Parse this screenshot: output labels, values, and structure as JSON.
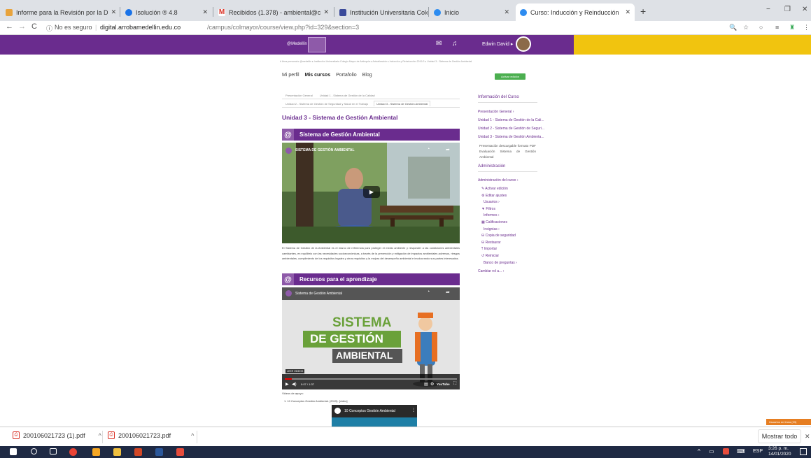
{
  "browser": {
    "tabs": [
      {
        "title": "Informe para la Revisión por la D",
        "color": "#e8a33c"
      },
      {
        "title": "Isolución ® 4.8",
        "color": "#1a73e8"
      },
      {
        "title": "Recibidos (1.378) - ambiental@c",
        "color": "#d93025"
      },
      {
        "title": "Institución Universitaria Colegio",
        "color": "#3b4a9a"
      },
      {
        "title": "Inicio",
        "color": "#2d8cf0"
      },
      {
        "title": "Curso: Inducción y Reinducción",
        "color": "#2d8cf0"
      }
    ],
    "new_tab": "+",
    "window_controls": [
      "−",
      "❐",
      "✕"
    ],
    "security_label": "No es seguro",
    "url_host": "digital.arrobamedellin.edu.co",
    "url_path": "/campus/colmayor/course/view.php?id=329&section=3"
  },
  "site_header": {
    "logo_text": "@Medellín",
    "user_name": "Edwin David ▸"
  },
  "course": {
    "breadcrumb": "# Área personal ▸ @medellín ▸ Institución Universitaria Colegio Mayor de Antioquia ▸ Actualización ▸ Inducción y Reinducción 2019-2 ▸ Unidad 3 - Sistema de Gestión Ambiental",
    "nav": [
      "Mi perfil",
      "Mis cursos",
      "Portafolio",
      "Blog"
    ],
    "edit_button": "Activar edición",
    "unit_tabs_row1": [
      "Presentación General",
      "Unidad 1 - Sistema de Gestión de la Calidad"
    ],
    "unit_tabs_row2": [
      "Unidad 2 - Sistema de Gestión de Seguridad y Salud en el Trabajo",
      "Unidad 3 - Sistema de Gestión Ambiental"
    ],
    "page_title": "Unidad 3 - Sistema de Gestión Ambiental",
    "section1_title": "Sistema de Gestión Ambiental",
    "video1_title": "SISTEMA DE GESTIÓN AMBIENTAL",
    "description": "El Sistema de Gestión de la Ambiental es el marco de referencia para proteger el medio ambiente y responder a las condiciones ambientales cambiantes, en equilibrio con las necesidades socioeconómicas, a través de la prevención y mitigación de impactos ambientales adversos, riesgos ambientales, cumplimiento de los requisitos legales y otros requisitos y la mejora del desempeño ambiental e involucrando sus partes interesadas.",
    "section2_title": "Recursos para el aprendizaje",
    "video2_title": "Sistema de Gestión Ambiental",
    "video2_line1": "SISTEMA",
    "video2_line2": "DE GESTIÓN",
    "video2_line3": "AMBIENTAL",
    "video2_time": "0:07 / 1:37",
    "video2_badge": "LEER VIDEOS",
    "videos_label": "Videos de apoyo:",
    "video_item": "1. 10 Conceptos Gestión Ambiental. (2019). [video]",
    "video3_title": "10 Conceptos Gestión Ambiental"
  },
  "sidebar": {
    "info_title": "Información del Curso",
    "info_links": [
      "Presentación General ›",
      "Unidad 1 - Sistema de Gestión de la Cali...",
      "Unidad 2 - Sistema de Gestión de Seguri...",
      "Unidad 3 - Sistema de Gestión Ambienta..."
    ],
    "downloads_text": "Presentación descargable formato PDF Evaluación Sistema de Gestión Ambiental",
    "admin_title": "Administración",
    "admin_items": [
      "Administración del curso ›",
      "✎ Activar edición",
      "⚙ Editar ajustes",
      "Usuarios ›",
      "▼ Filtros",
      "Informes ›",
      "▦ Calificaciones",
      "Insignias ›",
      "⛁ Copia de seguridad",
      "⛁ Restaurar",
      "⤒ Importar",
      "↺ Reiniciar",
      "Banco de preguntas ›"
    ],
    "change_role": "Cambiar rol a... ›"
  },
  "chat_widget": "Usuarios en línea (23)",
  "downloads_bar": {
    "items": [
      "200106021723 (1).pdf",
      "200106021723.pdf"
    ],
    "show_all": "Mostrar todo",
    "close": "✕"
  },
  "taskbar": {
    "language": "ESP",
    "time": "3:26 p. m.",
    "date": "14/01/2020"
  }
}
